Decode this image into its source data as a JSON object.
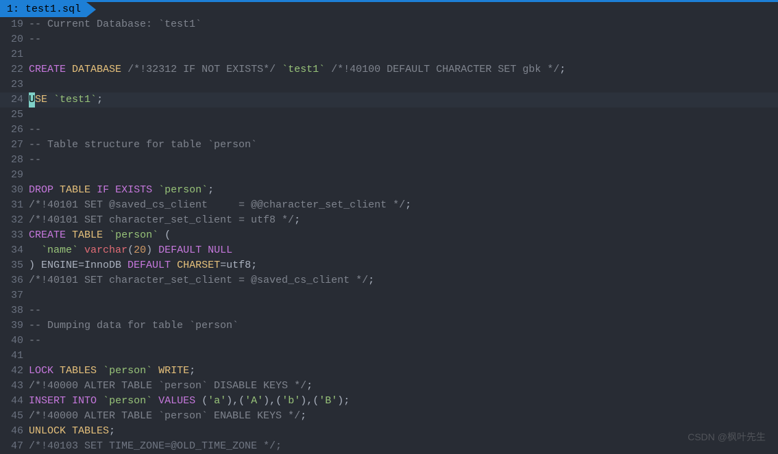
{
  "tab": {
    "index": "1:",
    "name": "test1.sql"
  },
  "watermark": "CSDN @枫叶先生",
  "lines": [
    {
      "n": "19",
      "tokens": [
        [
          "cmt",
          "-- Current Database: `test1`"
        ]
      ]
    },
    {
      "n": "20",
      "tokens": [
        [
          "cmt",
          "--"
        ]
      ]
    },
    {
      "n": "21",
      "tokens": []
    },
    {
      "n": "22",
      "tokens": [
        [
          "kw",
          "CREATE"
        ],
        [
          "wht",
          " "
        ],
        [
          "id",
          "DATABASE"
        ],
        [
          "wht",
          " "
        ],
        [
          "cmt",
          "/*!32312 IF NOT EXISTS*/"
        ],
        [
          "wht",
          " "
        ],
        [
          "str",
          "`test1`"
        ],
        [
          "wht",
          " "
        ],
        [
          "cmt",
          "/*!40100 DEFAULT CHARACTER SET gbk */"
        ],
        [
          "wht",
          ";"
        ]
      ]
    },
    {
      "n": "23",
      "tokens": []
    },
    {
      "n": "24",
      "current": true,
      "cursor": "U",
      "tokens": [
        [
          "id",
          "SE"
        ],
        [
          "wht",
          " "
        ],
        [
          "str",
          "`test1`"
        ],
        [
          "wht",
          ";"
        ]
      ]
    },
    {
      "n": "25",
      "tokens": []
    },
    {
      "n": "26",
      "tokens": [
        [
          "cmt",
          "--"
        ]
      ]
    },
    {
      "n": "27",
      "tokens": [
        [
          "cmt",
          "-- Table structure for table `person`"
        ]
      ]
    },
    {
      "n": "28",
      "tokens": [
        [
          "cmt",
          "--"
        ]
      ]
    },
    {
      "n": "29",
      "tokens": []
    },
    {
      "n": "30",
      "tokens": [
        [
          "kw",
          "DROP"
        ],
        [
          "wht",
          " "
        ],
        [
          "id",
          "TABLE"
        ],
        [
          "wht",
          " "
        ],
        [
          "kw",
          "IF"
        ],
        [
          "wht",
          " "
        ],
        [
          "kw",
          "EXISTS"
        ],
        [
          "wht",
          " "
        ],
        [
          "str",
          "`person`"
        ],
        [
          "wht",
          ";"
        ]
      ]
    },
    {
      "n": "31",
      "tokens": [
        [
          "cmt",
          "/*!40101 SET @saved_cs_client     = @@character_set_client */"
        ],
        [
          "wht",
          ";"
        ]
      ]
    },
    {
      "n": "32",
      "tokens": [
        [
          "cmt",
          "/*!40101 SET character_set_client = utf8 */"
        ],
        [
          "wht",
          ";"
        ]
      ]
    },
    {
      "n": "33",
      "tokens": [
        [
          "kw",
          "CREATE"
        ],
        [
          "wht",
          " "
        ],
        [
          "id",
          "TABLE"
        ],
        [
          "wht",
          " "
        ],
        [
          "str",
          "`person`"
        ],
        [
          "wht",
          " ("
        ]
      ]
    },
    {
      "n": "34",
      "tokens": [
        [
          "wht",
          "  "
        ],
        [
          "str",
          "`name`"
        ],
        [
          "wht",
          " "
        ],
        [
          "red",
          "varchar"
        ],
        [
          "wht",
          "("
        ],
        [
          "num",
          "20"
        ],
        [
          "wht",
          ") "
        ],
        [
          "kw",
          "DEFAULT"
        ],
        [
          "wht",
          " "
        ],
        [
          "kw",
          "NULL"
        ]
      ]
    },
    {
      "n": "35",
      "tokens": [
        [
          "wht",
          ") ENGINE"
        ],
        [
          "wht",
          "=InnoDB "
        ],
        [
          "kw",
          "DEFAULT"
        ],
        [
          "wht",
          " "
        ],
        [
          "id",
          "CHARSET"
        ],
        [
          "wht",
          "=utf8;"
        ]
      ]
    },
    {
      "n": "36",
      "tokens": [
        [
          "cmt",
          "/*!40101 SET character_set_client = @saved_cs_client */"
        ],
        [
          "wht",
          ";"
        ]
      ]
    },
    {
      "n": "37",
      "tokens": []
    },
    {
      "n": "38",
      "tokens": [
        [
          "cmt",
          "--"
        ]
      ]
    },
    {
      "n": "39",
      "tokens": [
        [
          "cmt",
          "-- Dumping data for table `person`"
        ]
      ]
    },
    {
      "n": "40",
      "tokens": [
        [
          "cmt",
          "--"
        ]
      ]
    },
    {
      "n": "41",
      "tokens": []
    },
    {
      "n": "42",
      "tokens": [
        [
          "kw",
          "LOCK"
        ],
        [
          "wht",
          " "
        ],
        [
          "id",
          "TABLES"
        ],
        [
          "wht",
          " "
        ],
        [
          "str",
          "`person`"
        ],
        [
          "wht",
          " "
        ],
        [
          "id",
          "WRITE"
        ],
        [
          "wht",
          ";"
        ]
      ]
    },
    {
      "n": "43",
      "tokens": [
        [
          "cmt",
          "/*!40000 ALTER TABLE `person` DISABLE KEYS */"
        ],
        [
          "wht",
          ";"
        ]
      ]
    },
    {
      "n": "44",
      "tokens": [
        [
          "kw",
          "INSERT"
        ],
        [
          "wht",
          " "
        ],
        [
          "kw",
          "INTO"
        ],
        [
          "wht",
          " "
        ],
        [
          "str",
          "`person`"
        ],
        [
          "wht",
          " "
        ],
        [
          "kw",
          "VALUES"
        ],
        [
          "wht",
          " ("
        ],
        [
          "str",
          "'a'"
        ],
        [
          "wht",
          "),("
        ],
        [
          "str",
          "'A'"
        ],
        [
          "wht",
          "),("
        ],
        [
          "str",
          "'b'"
        ],
        [
          "wht",
          "),("
        ],
        [
          "str",
          "'B'"
        ],
        [
          "wht",
          ");"
        ]
      ]
    },
    {
      "n": "45",
      "tokens": [
        [
          "cmt",
          "/*!40000 ALTER TABLE `person` ENABLE KEYS */"
        ],
        [
          "wht",
          ";"
        ]
      ]
    },
    {
      "n": "46",
      "tokens": [
        [
          "id",
          "UNLOCK"
        ],
        [
          "wht",
          " "
        ],
        [
          "id",
          "TABLES"
        ],
        [
          "wht",
          ";"
        ]
      ]
    },
    {
      "n": "47",
      "tokens": [
        [
          "dim",
          "/*!40103 SET TIME_ZONE=@OLD_TIME_ZONE */;"
        ]
      ]
    }
  ]
}
